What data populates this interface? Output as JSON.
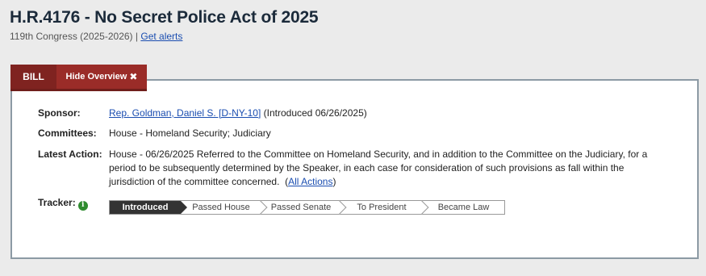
{
  "header": {
    "title": "H.R.4176 - No Secret Police Act of 2025",
    "congress": "119th Congress (2025-2026)",
    "separator": "|",
    "alerts_link": "Get alerts"
  },
  "tabs": {
    "bill_label": "BILL",
    "hide_label": "Hide Overview",
    "hide_icon": "✖"
  },
  "overview": {
    "sponsor_label": "Sponsor:",
    "sponsor_link": "Rep. Goldman, Daniel S. [D-NY-10]",
    "sponsor_note": "(Introduced 06/26/2025)",
    "committees_label": "Committees:",
    "committees_value": "House - Homeland Security; Judiciary",
    "latest_action_label": "Latest Action:",
    "latest_action_text": "House - 06/26/2025 Referred to the Committee on Homeland Security, and in addition to the Committee on the Judiciary, for a period to be subsequently determined by the Speaker, in each case for consideration of such provisions as fall within the jurisdiction of the committee concerned.",
    "all_actions_link": "All Actions",
    "tracker_label": "Tracker:",
    "tracker_icon": "i"
  },
  "tracker": {
    "steps": [
      "Introduced",
      "Passed House",
      "Passed Senate",
      "To President",
      "Became Law"
    ],
    "active_index": 0
  }
}
